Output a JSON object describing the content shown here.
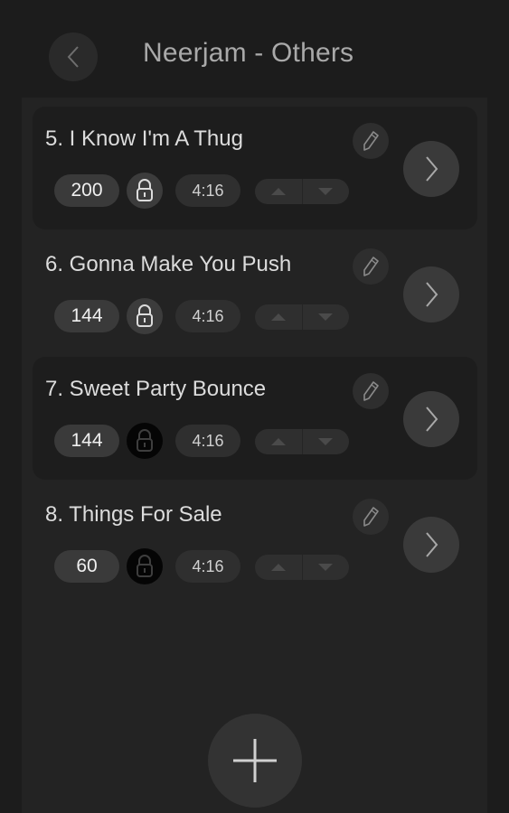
{
  "header": {
    "title": "Neerjam - Others"
  },
  "songs": [
    {
      "title": "5. I Know I'm A Thug",
      "bpm": "200",
      "locked": true,
      "duration": "4:16"
    },
    {
      "title": "6. Gonna Make You Push",
      "bpm": "144",
      "locked": true,
      "duration": "4:16"
    },
    {
      "title": "7. Sweet Party Bounce",
      "bpm": "144",
      "locked": false,
      "duration": "4:16"
    },
    {
      "title": "8. Things For Sale",
      "bpm": "60",
      "locked": false,
      "duration": "4:16"
    }
  ],
  "icons": {
    "back": "chevron-left-icon",
    "edit": "pencil-icon",
    "lock": "padlock-icon",
    "move_up": "triangle-up-icon",
    "move_down": "triangle-down-icon",
    "open": "chevron-right-icon",
    "add": "plus-icon"
  },
  "colors": {
    "background": "#1c1c1c",
    "panel": "#232323",
    "pill": "#3a3a3a",
    "unlocked_lock_bg": "#050505"
  }
}
